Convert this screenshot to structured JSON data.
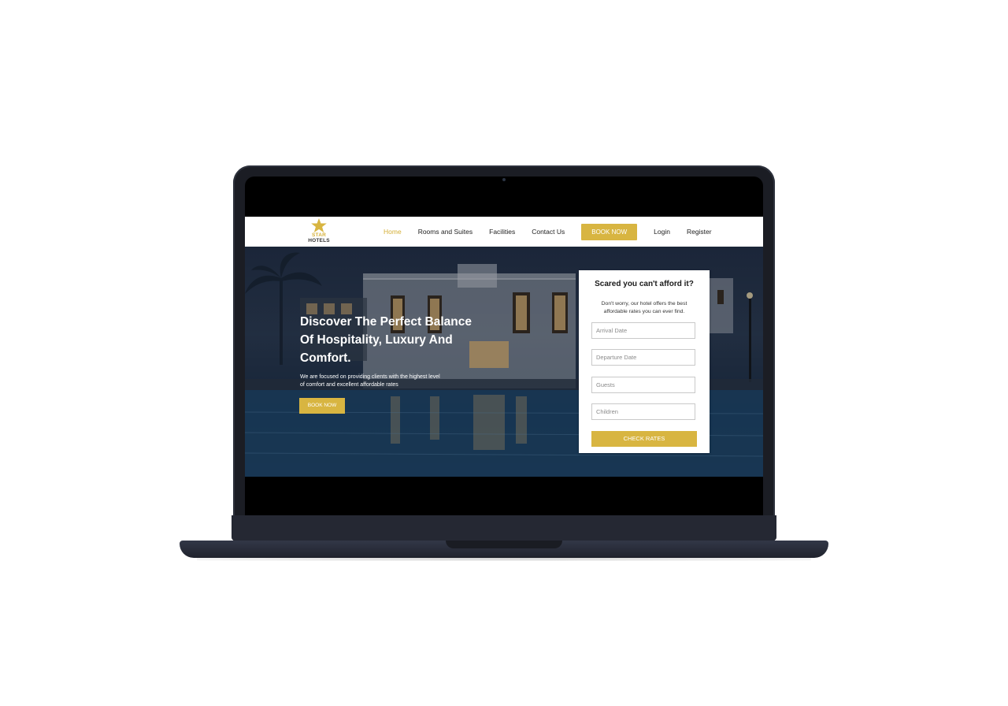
{
  "nav": {
    "logo_primary": "STAR",
    "logo_secondary": "HOTELS",
    "links": [
      "Home",
      "Rooms and Suites",
      "Facilities",
      "Contact Us"
    ],
    "book_now": "BOOK NOW",
    "login": "Login",
    "register": "Register"
  },
  "hero": {
    "title_lines": [
      "Discover The Perfect Balance",
      "Of Hospitality, Luxury And",
      "Comfort."
    ],
    "subtitle_lines": [
      "We are focused on providing clients with the highest level",
      "of comfort and excellent affordable rates"
    ],
    "cta": "BOOK NOW"
  },
  "rates_card": {
    "title": "Scared you can't afford it?",
    "desc_lines": [
      "Don't worry, our hotel offers the best",
      "affordable rates you can ever find."
    ],
    "fields": [
      {
        "placeholder": "Arrival Date"
      },
      {
        "placeholder": "Departure Date"
      },
      {
        "placeholder": "Guests"
      },
      {
        "placeholder": "Children"
      }
    ],
    "submit": "CHECK RATES"
  },
  "colors": {
    "accent": "#d8b541",
    "laptop_body": "#1b1d24"
  },
  "icons": [
    "star-icon"
  ]
}
